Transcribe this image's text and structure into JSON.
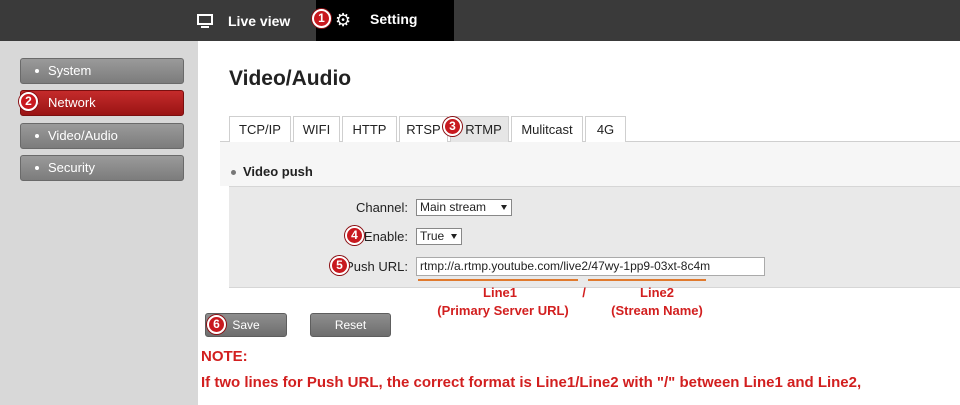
{
  "topbar": {
    "live_view_label": "Live view",
    "setting_label": "Setting",
    "live_icon": "monitor-icon",
    "setting_icon": "gear-icon"
  },
  "callouts": [
    "1",
    "2",
    "3",
    "4",
    "5",
    "6"
  ],
  "sidebar": {
    "items": [
      {
        "label": "System",
        "active": false
      },
      {
        "label": "Network",
        "active": true
      },
      {
        "label": "Video/Audio",
        "active": false
      },
      {
        "label": "Security",
        "active": false
      }
    ]
  },
  "main": {
    "title": "Video/Audio",
    "tabs": [
      "TCP/IP",
      "WIFI",
      "HTTP",
      "RTSP",
      "RTMP",
      "Mulitcast",
      "4G"
    ],
    "active_tab": "RTMP",
    "section_title": "Video push",
    "form": {
      "channel_label": "Channel:",
      "channel_value": "Main stream",
      "enable_label": "Enable:",
      "enable_value": "True",
      "push_url_label": "Push URL:",
      "push_url_value": "rtmp://a.rtmp.youtube.com/live2/47wy-1pp9-03xt-8c4m"
    },
    "annotations": {
      "line1": "Line1",
      "line1_sub": "(Primary Server URL)",
      "slash": "/",
      "line2": "Line2",
      "line2_sub": "(Stream Name)"
    },
    "buttons": {
      "save_label": "Save",
      "reset_label": "Reset"
    },
    "note_title": "NOTE:",
    "note_body": "If two lines for Push URL, the correct format is Line1/Line2 with \"/\" between Line1 and Line2,"
  },
  "colors": {
    "accent_red": "#c8191f",
    "annotation_red": "#d21f1f",
    "underline_orange": "#e07a2e"
  }
}
